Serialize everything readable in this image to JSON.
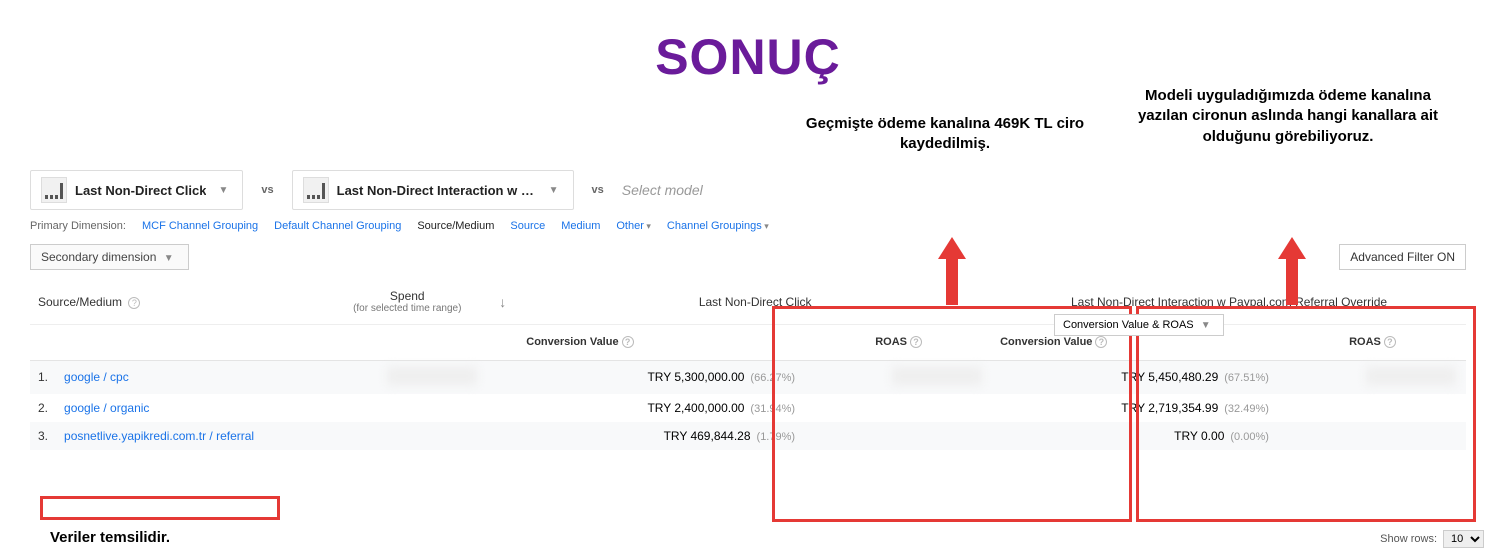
{
  "title": "SONUÇ",
  "annotations": {
    "a1": "Geçmişte ödeme kanalına 469K TL ciro kaydedilmiş.",
    "a2": "Modeli uyguladığımızda ödeme kanalına yazılan cironun aslında hangi kanallara ait olduğunu görebiliyoruz."
  },
  "models": {
    "m1": "Last Non-Direct Click",
    "m2": "Last Non-Direct Interaction w P...",
    "vs": "vs",
    "select": "Select model"
  },
  "dimensions": {
    "label": "Primary Dimension:",
    "items": [
      "MCF Channel Grouping",
      "Default Channel Grouping",
      "Source/Medium",
      "Source",
      "Medium",
      "Other",
      "Channel Groupings"
    ],
    "active": "Source/Medium"
  },
  "secondary": {
    "label": "Secondary dimension",
    "advanced": "Advanced Filter ON"
  },
  "conv_dropdown": "Conversion Value & ROAS",
  "headers": {
    "source": "Source/Medium",
    "spend": "Spend",
    "spend_sub": "(for selected time range)",
    "group1": "Last Non-Direct Click",
    "group2": "Last Non-Direct Interaction w Paypal.com Referral Override",
    "cv": "Conversion Value",
    "roas": "ROAS"
  },
  "rows": [
    {
      "idx": "1.",
      "src": "google / cpc",
      "cv1": "TRY 5,300,000.00",
      "p1": "(66.27%)",
      "cv2": "TRY 5,450,480.29",
      "p2": "(67.51%)"
    },
    {
      "idx": "2.",
      "src": "google / organic",
      "cv1": "TRY 2,400,000.00",
      "p1": "(31.94%)",
      "cv2": "TRY 2,719,354.99",
      "p2": "(32.49%)"
    },
    {
      "idx": "3.",
      "src": "posnetlive.yapikredi.com.tr / referral",
      "cv1": "TRY 469,844.28",
      "p1": "(1.79%)",
      "cv2": "TRY 0.00",
      "p2": "(0.00%)"
    }
  ],
  "footer": {
    "note": "Veriler temsilidir.",
    "show_rows_label": "Show rows:",
    "show_rows_value": "10"
  }
}
